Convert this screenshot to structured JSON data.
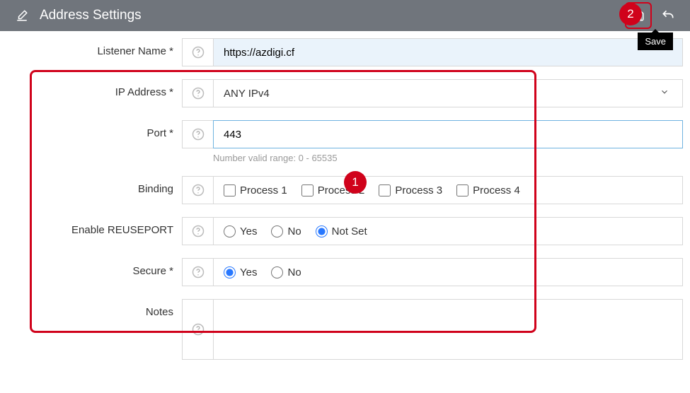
{
  "header": {
    "title": "Address Settings",
    "saveTooltip": "Save"
  },
  "callouts": {
    "c1": "1",
    "c2": "2"
  },
  "form": {
    "listenerName": {
      "label": "Listener Name *",
      "value": "https://azdigi.cf"
    },
    "ipAddress": {
      "label": "IP Address *",
      "value": "ANY IPv4"
    },
    "port": {
      "label": "Port *",
      "value": "443",
      "hint": "Number valid range: 0 - 65535"
    },
    "binding": {
      "label": "Binding",
      "options": [
        {
          "label": "Process 1",
          "checked": false
        },
        {
          "label": "Process 2",
          "checked": false
        },
        {
          "label": "Process 3",
          "checked": false
        },
        {
          "label": "Process 4",
          "checked": false
        }
      ]
    },
    "reuseport": {
      "label": "Enable REUSEPORT",
      "options": [
        {
          "label": "Yes",
          "checked": false
        },
        {
          "label": "No",
          "checked": false
        },
        {
          "label": "Not Set",
          "checked": true
        }
      ]
    },
    "secure": {
      "label": "Secure *",
      "options": [
        {
          "label": "Yes",
          "checked": true
        },
        {
          "label": "No",
          "checked": false
        }
      ]
    },
    "notes": {
      "label": "Notes",
      "value": ""
    }
  }
}
